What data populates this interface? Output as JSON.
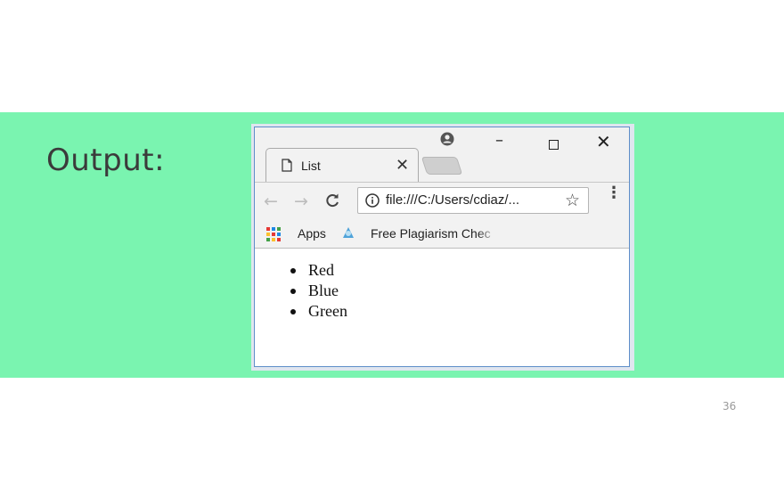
{
  "slide": {
    "heading": "Output:",
    "page_number": "36"
  },
  "browser": {
    "tab": {
      "title": "List",
      "close_glyph": "✕"
    },
    "window_controls": {
      "minimize_glyph": "–",
      "close_glyph": "✕"
    },
    "toolbar": {
      "back_glyph": "←",
      "forward_glyph": "→",
      "reload_glyph": "C",
      "url": "file:///C:/Users/cdiaz/...",
      "bookmark_star_glyph": "☆",
      "menu_glyph": "⋮"
    },
    "bookmarks": [
      {
        "label": "Apps",
        "icon": "apps-grid-icon"
      },
      {
        "label": "Free Plagiarism Chec",
        "icon": "bookmark-favicon"
      }
    ],
    "page_content": {
      "list_items": [
        "Red",
        "Blue",
        "Green"
      ]
    }
  },
  "colors": {
    "band": "#7af4b0",
    "window_border": "#5e8ec9"
  }
}
